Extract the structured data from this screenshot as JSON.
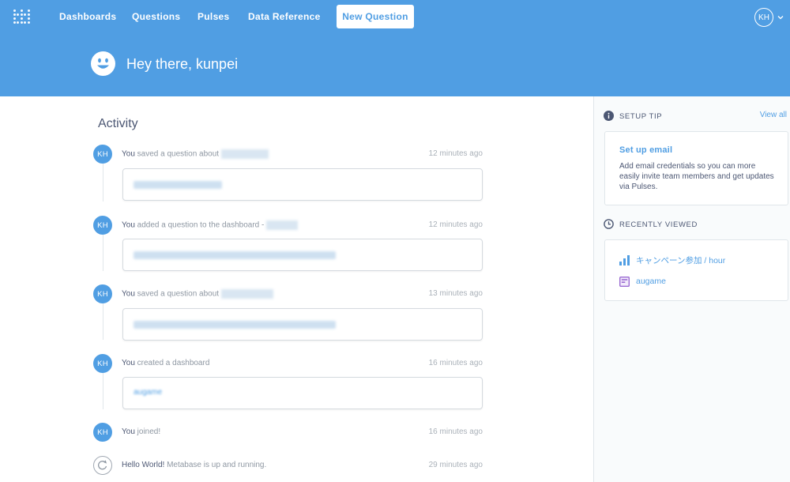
{
  "nav": {
    "links": [
      "Dashboards",
      "Questions",
      "Pulses",
      "Data Reference"
    ],
    "new_question": "New Question",
    "user_initials": "KH"
  },
  "greeting": "Hey there, kunpei",
  "activity": {
    "title": "Activity",
    "items": [
      {
        "who": "You",
        "action": "saved a question about",
        "time": "12 minutes ago",
        "initials": "KH"
      },
      {
        "who": "You",
        "action": "added a question to the dashboard -",
        "time": "12 minutes ago",
        "initials": "KH"
      },
      {
        "who": "You",
        "action": "saved a question about",
        "time": "13 minutes ago",
        "initials": "KH"
      },
      {
        "who": "You",
        "action": "created a dashboard",
        "time": "16 minutes ago",
        "initials": "KH",
        "card_link": "augame"
      },
      {
        "who": "You",
        "action": "joined!",
        "time": "16 minutes ago",
        "initials": "KH"
      },
      {
        "who": "Hello World!",
        "action": "Metabase is up and running.",
        "time": "29 minutes ago"
      }
    ]
  },
  "sidebar": {
    "setup_tip": {
      "heading": "SETUP TIP",
      "view_all": "View all",
      "title": "Set up email",
      "body": "Add email credentials so you can more easily invite team members and get updates via Pulses."
    },
    "recently_viewed": {
      "heading": "RECENTLY VIEWED",
      "items": [
        {
          "label": "キャンペーン参加 / hour",
          "icon": "bar-chart-icon"
        },
        {
          "label": "augame",
          "icon": "dashboard-icon"
        }
      ]
    }
  },
  "colors": {
    "brand": "#509ee3",
    "text_dark": "#4c5773",
    "text_light": "#8e97a2"
  }
}
